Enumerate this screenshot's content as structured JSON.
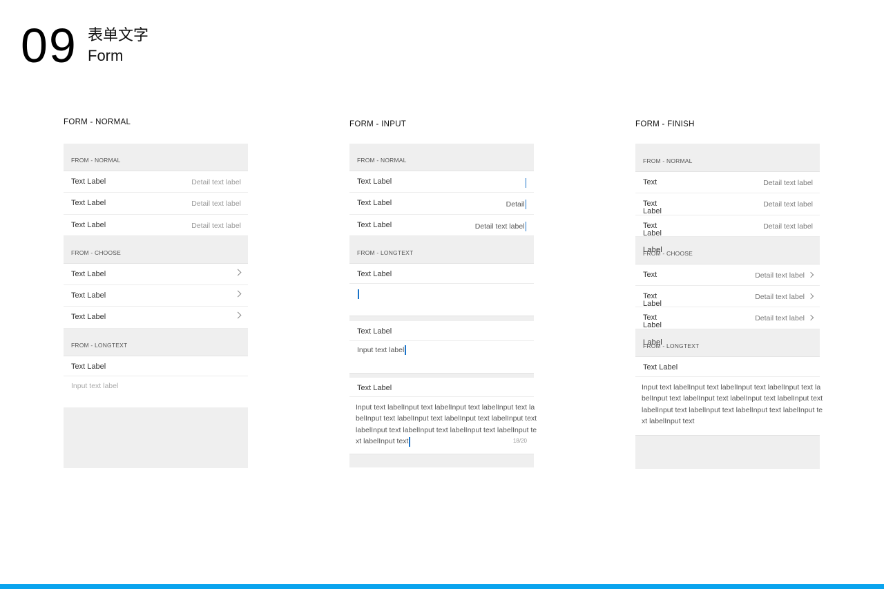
{
  "header": {
    "number": "09",
    "title_cn": "表单文字",
    "title_en": "Form"
  },
  "columns": {
    "normal": {
      "title": "FORM  -  NORMAL",
      "sec_normal": "FROM - NORMAL",
      "sec_choose": "FROM - CHOOSE",
      "sec_longtext": "FROM - LONGTEXT",
      "rows_normal": [
        {
          "label": "Text Label",
          "detail": "Detail text label"
        },
        {
          "label": "Text Label",
          "detail": "Detail text label"
        },
        {
          "label": "Text Label",
          "detail": "Detail text label"
        }
      ],
      "rows_choose": [
        {
          "label": "Text Label"
        },
        {
          "label": "Text Label"
        },
        {
          "label": "Text Label"
        }
      ],
      "longtext_label": "Text Label",
      "longtext_placeholder": "Input text label"
    },
    "input": {
      "title": "FORM  -  INPUT",
      "sec_normal": "FROM - NORMAL",
      "sec_longtext": "FROM - LONGTEXT",
      "rows_normal": [
        {
          "label": "Text Label",
          "value": ""
        },
        {
          "label": "Text Label",
          "value": "Detail"
        },
        {
          "label": "Text Label",
          "value": "Detail text label"
        }
      ],
      "long1_label": "Text Label",
      "long2_label": "Text Label",
      "long2_value": "Input text label",
      "long3_label": "Text Label",
      "long3_value": "Input text labelInput text labelInput text labelInput text labelInput text labelInput text labelInput text labelInput text labelInput text labelInput text labelInput text labelInput text labelInput text",
      "long3_counter": "18/20"
    },
    "finish": {
      "title": "FORM  -  FINISH",
      "sec_normal": "FROM - NORMAL",
      "sec_choose": "FROM - CHOOSE",
      "sec_longtext": "FROM - LONGTEXT",
      "rows_normal": [
        {
          "label": "Text",
          "detail": "Detail text label"
        },
        {
          "label": "Text",
          "detail": "Detail text label"
        },
        {
          "label": "Text",
          "detail": "Detail text label"
        }
      ],
      "rows_choose": [
        {
          "label": "Text",
          "detail": "Detail text label"
        },
        {
          "label": "Text",
          "detail": "Detail text label"
        },
        {
          "label": "Text",
          "detail": "Detail text label"
        }
      ],
      "overflow_label": "Label",
      "longtext_label": "Text Label",
      "longtext_value": "Input text labelInput text labelInput text labelInput text labelInput text labelInput text labelInput text labelInput text labelInput text labelInput text labelInput text labelInput text labelInput text"
    }
  },
  "colors": {
    "accent": "#0aa4ee",
    "cursor": "#1a73c8",
    "section_bg": "#efefef"
  }
}
